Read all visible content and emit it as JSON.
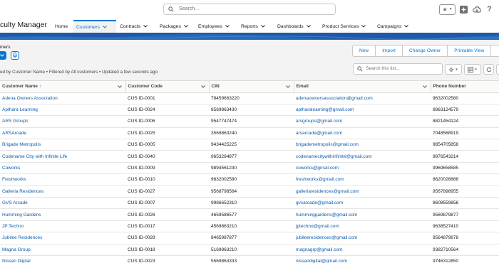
{
  "header": {
    "search_placeholder": "Search...",
    "icons": [
      "favorites-star-icon",
      "add-icon",
      "setup-cloud-icon",
      "help-icon",
      "settings-gear-icon"
    ]
  },
  "nav": {
    "app_name": "culty Manager",
    "items": [
      {
        "label": "Home",
        "has_menu": false
      },
      {
        "label": "Customers",
        "has_menu": true,
        "active": true
      },
      {
        "label": "Contracts",
        "has_menu": true
      },
      {
        "label": "Packages",
        "has_menu": true
      },
      {
        "label": "Employees",
        "has_menu": true
      },
      {
        "label": "Reports",
        "has_menu": true
      },
      {
        "label": "Dashboards",
        "has_menu": true
      },
      {
        "label": "Product Services",
        "has_menu": true
      },
      {
        "label": "Campaigns",
        "has_menu": true
      }
    ]
  },
  "list_view": {
    "object_label": "mers",
    "status": "ed by Customer Name • Filtered by All customers • Updated a few seconds ago",
    "actions": [
      "New",
      "Import",
      "Change Owner",
      "Printable View"
    ],
    "search_placeholder": "Search this list...",
    "accent_color": "#0176d3"
  },
  "table": {
    "columns": [
      "Customer Name",
      "Customer Code",
      "CIN",
      "Email",
      "Phone Number"
    ],
    "sorted_column": "Customer Name",
    "sort_direction": "ascending",
    "rows": [
      {
        "name": "Adena Owners Association",
        "code": "CUS ID-0001",
        "cin": "78459663220",
        "email": "adenaownersassociation@gmail.com",
        "phone": "9632002580"
      },
      {
        "name": "Apthara Learning",
        "code": "CUS ID-0024",
        "cin": "8569863430",
        "email": "aptharalearning@gmail.com",
        "phone": "8863124579"
      },
      {
        "name": "ARS Groups",
        "code": "CUS ID-0006",
        "cin": "9547747474",
        "email": "arsgroups@gmail.com",
        "phone": "8821454124"
      },
      {
        "name": "ARSArcade",
        "code": "CUS ID-0025",
        "cin": "3569863240",
        "email": "arsarcade@gmail.com",
        "phone": "7048568919"
      },
      {
        "name": "Brigade Metropolis",
        "code": "CUS ID-0005",
        "cin": "9434425225",
        "email": "brigademetropolis@gmail.com",
        "phone": "9854705858"
      },
      {
        "name": "Codename City with Infinite Life",
        "code": "CUS ID-0040",
        "cin": "9653264877",
        "email": "codenamecitywithinfinite@gmail.com",
        "phone": "9876543214"
      },
      {
        "name": "Coworks",
        "code": "CUS ID-0009",
        "cin": "9894561230",
        "email": "coworks@gmail.com",
        "phone": "9969658585"
      },
      {
        "name": "Freshworks",
        "code": "CUS ID-0010",
        "cin": "9632002580",
        "email": "freshworks@gmail.com",
        "phone": "8620026886"
      },
      {
        "name": "Galleria Residences",
        "code": "CUS ID-0027",
        "cin": "9568798564",
        "email": "galleriaresidences@gmail.com",
        "phone": "9567898955"
      },
      {
        "name": "GVS Arcade",
        "code": "CUS ID-0007",
        "cin": "9986652310",
        "email": "gvsarcade@gmail.com",
        "phone": "8608559856"
      },
      {
        "name": "Humming Gardens",
        "code": "CUS ID-0026",
        "cin": "4659586577",
        "email": "humminggardens@gmail.com",
        "phone": "9569879877"
      },
      {
        "name": "JP Techno",
        "code": "CUS ID-0017",
        "cin": "4569863210",
        "email": "jptechno@gmail.com",
        "phone": "9638527410"
      },
      {
        "name": "Jubilee Residences",
        "code": "CUS ID-0028",
        "cin": "8465987877",
        "email": "jubileeresidences@gmail.com",
        "phone": "9564879878"
      },
      {
        "name": "Magna Group",
        "code": "CUS ID-0018",
        "cin": "5169863210",
        "email": "magnagrp@gmail.com",
        "phone": "9382710564"
      },
      {
        "name": "Nissan Digital",
        "code": "CUS ID-0023",
        "cin": "5569863333",
        "email": "nissandigital@gmail.com",
        "phone": "9746312850"
      }
    ]
  }
}
